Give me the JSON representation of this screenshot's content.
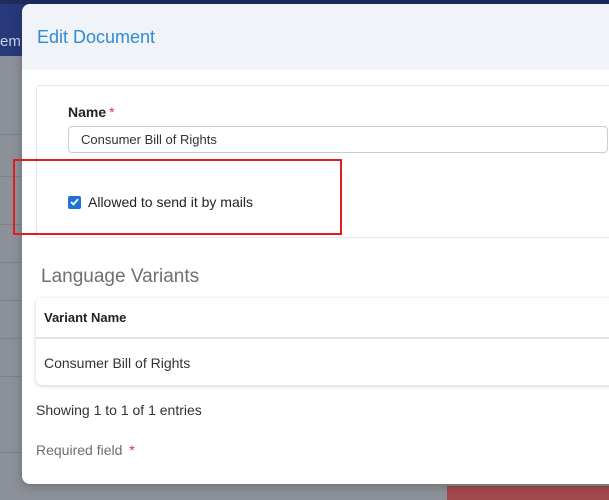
{
  "background": {
    "nav_fragment": "em"
  },
  "modal": {
    "title": "Edit Document",
    "name_label": "Name",
    "required_star": "*",
    "name_value": "Consumer Bill of Rights",
    "mail_checkbox_checked": true,
    "mail_label": "Allowed to send it by mails"
  },
  "language_variants": {
    "title": "Language Variants",
    "columns": [
      "Variant Name"
    ],
    "rows": [
      [
        "Consumer Bill of Rights"
      ]
    ],
    "showing": "Showing 1 to 1 of 1 entries"
  },
  "footer": {
    "required_note": "Required field",
    "required_star": "*"
  },
  "colors": {
    "accent": "#2f8bd2",
    "checkbox": "#1f73d8",
    "required": "#d9303f",
    "highlight": "#e21c1c"
  }
}
